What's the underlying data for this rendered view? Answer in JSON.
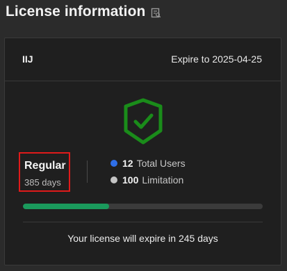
{
  "header": {
    "title": "License information",
    "icon": "license-detail-icon"
  },
  "license": {
    "product": "IIJ",
    "expire_text": "Expire to 2025-04-25",
    "shield_icon": "shield-check-icon",
    "shield_color": "#1a8c1a",
    "plan": {
      "name": "Regular",
      "days": "385 days",
      "highlight_color": "#e01a1a"
    },
    "stats": [
      {
        "number": "12",
        "label": "Total Users",
        "dot_color": "#2f6fe8"
      },
      {
        "number": "100",
        "label": "Limitation",
        "dot_color": "#c4c4c4"
      }
    ],
    "progress": {
      "fraction": 0.36,
      "fill_color": "#1a9a5c"
    },
    "footer": "Your license will expire in 245 days"
  }
}
